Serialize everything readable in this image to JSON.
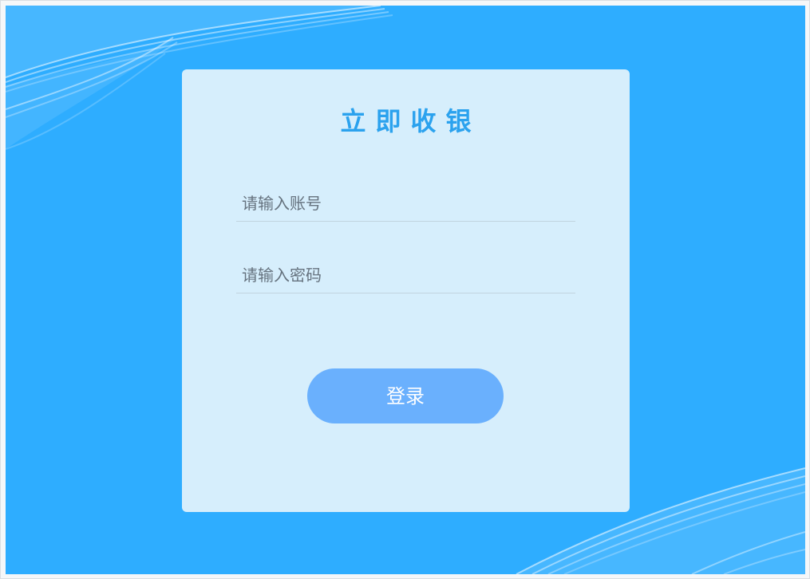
{
  "login": {
    "title": "立即收银",
    "account_placeholder": "请输入账号",
    "password_placeholder": "请输入密码",
    "submit_label": "登录"
  },
  "colors": {
    "background": "#2eadff",
    "card": "#d6eefc",
    "title": "#2ba2ee",
    "button": "#6ab0fd",
    "button_text": "#ffffff"
  }
}
